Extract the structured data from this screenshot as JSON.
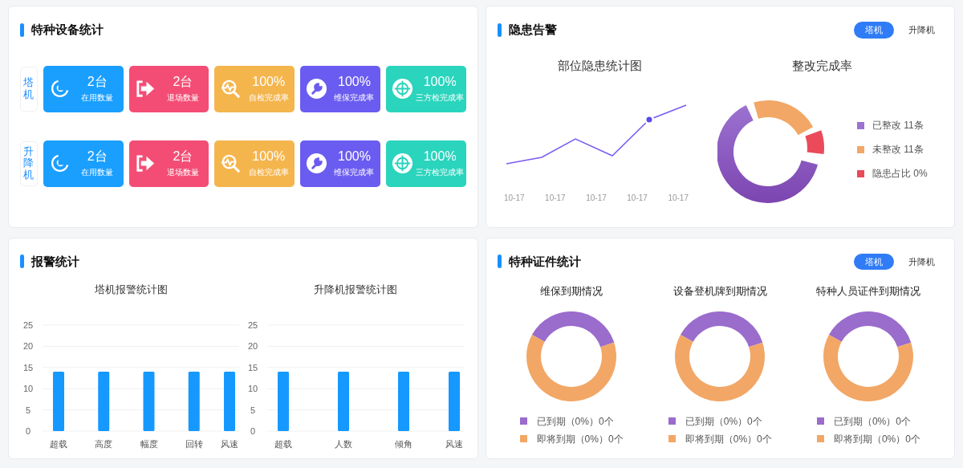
{
  "equipment_panel": {
    "title": "特种设备统计",
    "groups": [
      {
        "label": "塔机",
        "tiles": [
          {
            "kind": "in-use",
            "value": "2台",
            "label": "在用数量",
            "color": "#1a9fff"
          },
          {
            "kind": "exit",
            "value": "2台",
            "label": "退场数量",
            "color": "#f44d75"
          },
          {
            "kind": "self-check",
            "value": "100%",
            "label": "自检完成率",
            "color": "#f5b54d"
          },
          {
            "kind": "maintenance",
            "value": "100%",
            "label": "维保完成率",
            "color": "#6a5cf0"
          },
          {
            "kind": "third-party",
            "value": "100%",
            "label": "三方检完成率",
            "color": "#2ad4bd"
          }
        ]
      },
      {
        "label": "升降机",
        "tiles": [
          {
            "kind": "in-use",
            "value": "2台",
            "label": "在用数量",
            "color": "#1a9fff"
          },
          {
            "kind": "exit",
            "value": "2台",
            "label": "退场数量",
            "color": "#f44d75"
          },
          {
            "kind": "self-check",
            "value": "100%",
            "label": "自检完成率",
            "color": "#f5b54d"
          },
          {
            "kind": "maintenance",
            "value": "100%",
            "label": "维保完成率",
            "color": "#6a5cf0"
          },
          {
            "kind": "third-party",
            "value": "100%",
            "label": "三方检完成率",
            "color": "#2ad4bd"
          }
        ]
      }
    ]
  },
  "hazard_panel": {
    "title": "隐患告警",
    "tabs": [
      {
        "label": "塔机",
        "selected": true
      },
      {
        "label": "升降机",
        "selected": false
      }
    ],
    "line_chart": {
      "title": "部位隐患统计图",
      "x_labels": [
        "10-17",
        "10-17",
        "10-17",
        "10-17",
        "10-17"
      ]
    },
    "donut": {
      "title": "整改完成率",
      "legend": [
        {
          "label": "已整改 11条",
          "color": "#9b72d0"
        },
        {
          "label": "未整改 11条",
          "color": "#f2a766"
        },
        {
          "label": "隐患占比 0%",
          "color": "#ea4a5a"
        }
      ]
    }
  },
  "alarm_panel": {
    "title": "报警统计",
    "charts": [
      {
        "chart_data": {
          "type": "bar",
          "title": "塔机报警统计图",
          "categories": [
            "超载",
            "高度",
            "幅度",
            "回转",
            "风速"
          ],
          "values": [
            14,
            14,
            14,
            14,
            14
          ],
          "ylim": [
            0,
            25
          ],
          "yticks": [
            0,
            5,
            10,
            15,
            20,
            25
          ],
          "grid": true
        }
      },
      {
        "chart_data": {
          "type": "bar",
          "title": "升降机报警统计图",
          "categories": [
            "超载",
            "人数",
            "倾角",
            "风速"
          ],
          "values": [
            14,
            14,
            14,
            14
          ],
          "ylim": [
            0,
            25
          ],
          "yticks": [
            0,
            5,
            10,
            15,
            20,
            25
          ],
          "grid": true
        }
      }
    ]
  },
  "certificate_panel": {
    "title": "特种证件统计",
    "tabs": [
      {
        "label": "塔机",
        "selected": true
      },
      {
        "label": "升降机",
        "selected": false
      }
    ],
    "donuts": [
      {
        "title": "维保到期情况",
        "legend": [
          {
            "label": "已到期（0%）0个",
            "color": "#9a6ccc"
          },
          {
            "label": "即将到期（0%）0个",
            "color": "#f2a766"
          }
        ]
      },
      {
        "title": "设备登机牌到期情况",
        "legend": [
          {
            "label": "已到期（0%）0个",
            "color": "#9a6ccc"
          },
          {
            "label": "即将到期（0%）0个",
            "color": "#f2a766"
          }
        ]
      },
      {
        "title": "特种人员证件到期情况",
        "legend": [
          {
            "label": "已到期（0%）0个",
            "color": "#9a6ccc"
          },
          {
            "label": "即将到期（0%）0个",
            "color": "#f2a766"
          }
        ]
      }
    ]
  }
}
